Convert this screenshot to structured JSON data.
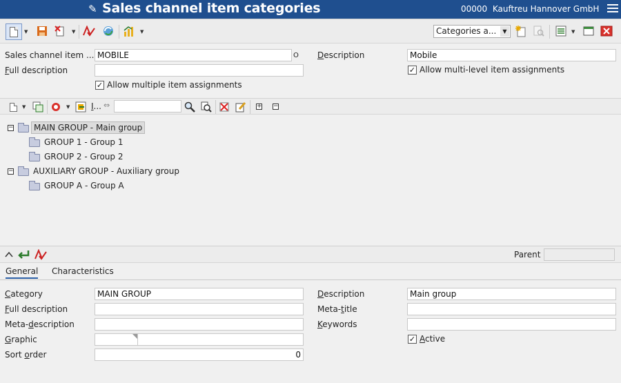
{
  "window": {
    "title": "Sales channel item categories",
    "company_code": "00000",
    "company_name": "Kauftreu Hannover GmbH"
  },
  "toolbar": {
    "view_select": "Categories a..."
  },
  "header_form": {
    "sales_channel_label": "Sales channel item ...",
    "sales_channel_value": "MOBILE",
    "sales_channel_suffix": "O",
    "full_description_label_pre": "F",
    "full_description_label_rest": "ull description",
    "full_description_value": "",
    "allow_multiple_label": "Allow multiple item assignments",
    "allow_multiple_checked": "✓",
    "description_label_pre": "D",
    "description_label_rest": "escription",
    "description_value": "Mobile",
    "allow_multilevel_label": "Allow multi-level item assignments",
    "allow_multilevel_checked": "✓"
  },
  "tree": {
    "filter_label_pre": "I",
    "filter_label_rest": "...",
    "filter_value": "",
    "nodes": [
      {
        "label": "MAIN GROUP - Main group",
        "toggle": "−"
      },
      {
        "label": "GROUP 1 - Group 1"
      },
      {
        "label": "GROUP 2 - Group 2"
      },
      {
        "label": "AUXILIARY GROUP - Auxiliary group",
        "toggle": "−"
      },
      {
        "label": "GROUP A - Group A"
      }
    ]
  },
  "detail_bar": {
    "parent_label": "Parent",
    "parent_value": ""
  },
  "tabs": [
    {
      "label": "General"
    },
    {
      "label": "Characteristics"
    }
  ],
  "detail_form": {
    "category_label_pre": "C",
    "category_label_rest": "ategory",
    "category_value": "MAIN GROUP",
    "full_description_label_pre": "F",
    "full_description_label_rest": "ull description",
    "full_description_value": "",
    "meta_description_label_pre": "Meta-",
    "meta_description_label_u": "d",
    "meta_description_label_rest": "escription",
    "meta_description_value": "",
    "graphic_label_pre": "G",
    "graphic_label_rest": "raphic",
    "graphic_value": "",
    "sort_order_label_pre": "Sort ",
    "sort_order_label_u": "o",
    "sort_order_label_rest": "rder",
    "sort_order_value": "0",
    "description_label_pre": "D",
    "description_label_rest": "escription",
    "description_value": "Main group",
    "meta_title_label_pre": "Meta-",
    "meta_title_label_u": "t",
    "meta_title_label_rest": "itle",
    "meta_title_value": "",
    "keywords_label_pre": "K",
    "keywords_label_rest": "eywords",
    "keywords_value": "",
    "active_label_pre": "A",
    "active_label_rest": "ctive",
    "active_checked": "✓"
  }
}
